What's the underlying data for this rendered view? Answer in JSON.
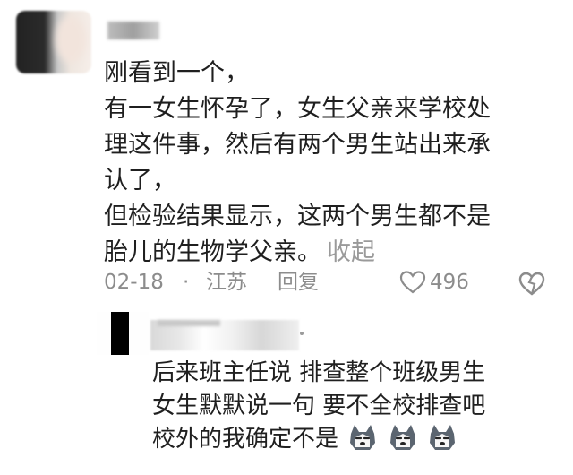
{
  "main_comment": {
    "lines": [
      "刚看到一个，",
      "有一女生怀孕了，女生父亲来学校处",
      "理这件事，然后有两个男生站出来承",
      "认了，",
      "但检验结果显示，这两个男生都不是",
      "胎儿的生物学父亲。"
    ],
    "collapse_label": "收起"
  },
  "meta": {
    "date": "02-18",
    "separator": "·",
    "location": "江苏",
    "reply_label": "回复",
    "like_count": "496"
  },
  "reply": {
    "lines": [
      "后来班主任说 排查整个班级男生",
      "女生默默说一句  要不全校排查吧",
      "校外的我确定不是"
    ],
    "emoji": [
      "husky-emoji",
      "husky-emoji",
      "husky-emoji"
    ]
  },
  "colors": {
    "text": "#1f1f1f",
    "muted": "#8c8c8c",
    "background": "#ffffff"
  }
}
